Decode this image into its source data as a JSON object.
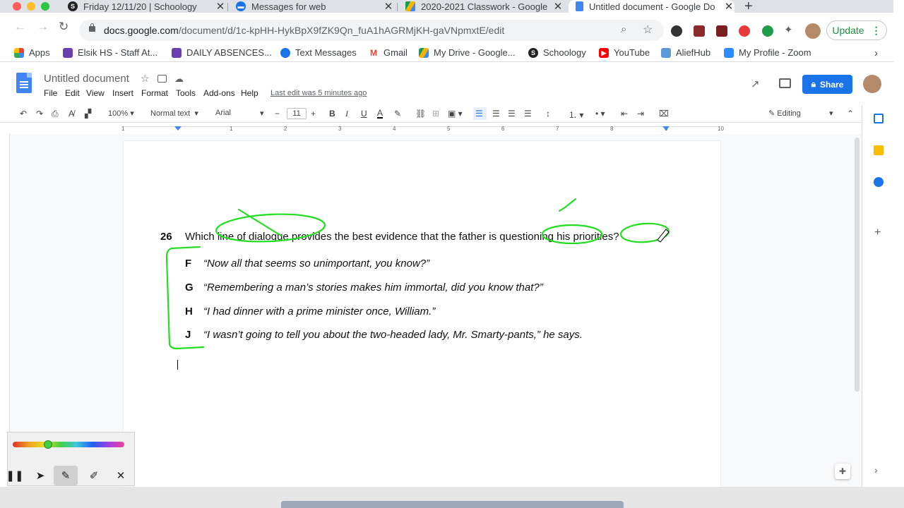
{
  "browser": {
    "tabs": [
      {
        "title": "Friday 12/11/20 | Schoology",
        "icon": "schoology-icon"
      },
      {
        "title": "Messages for web",
        "icon": "messages-icon"
      },
      {
        "title": "2020-2021 Classwork - Google",
        "icon": "google-drive-icon"
      },
      {
        "title": "Untitled document - Google Do",
        "icon": "google-docs-icon"
      }
    ],
    "new_tab": "+",
    "url_host": "docs.google.com",
    "url_path": "/document/d/1c-kpHH-HykBpX9fZK9Qn_fuA1hAGRMjKH-gaVNpmxtE/edit",
    "update_label": "Update",
    "bookmarks": [
      "Apps",
      "Elsik HS - Staff At...",
      "DAILY ABSENCES...",
      "Text Messages",
      "Gmail",
      "My Drive - Google...",
      "Schoology",
      "YouTube",
      "AliefHub",
      "My Profile - Zoom"
    ],
    "bookmarks_more": "›"
  },
  "docs": {
    "title": "Untitled document",
    "menus": [
      "File",
      "Edit",
      "View",
      "Insert",
      "Format",
      "Tools",
      "Add-ons",
      "Help"
    ],
    "last_edit": "Last edit was 5 minutes ago",
    "share_label": "Share",
    "toolbar": {
      "zoom": "100%",
      "style": "Normal text",
      "font": "Arial",
      "font_size": "11",
      "mode": "Editing"
    },
    "ruler_numbers": [
      "1",
      "1",
      "2",
      "3",
      "4",
      "5",
      "6",
      "7",
      "8",
      "9",
      "10"
    ]
  },
  "question": {
    "number": "26",
    "text": "Which line of dialogue provides the best evidence that the father is questioning his priorities?",
    "options": [
      {
        "letter": "F",
        "text": "“Now all that seems so unimportant, you know?”"
      },
      {
        "letter": "G",
        "text": "“Remembering a man’s stories makes him immortal, did you know that?”"
      },
      {
        "letter": "H",
        "text": "“I had dinner with a prime minister once, William.”"
      },
      {
        "letter": "J",
        "text": "“I wasn’t going to tell you about the two-headed lady, Mr. Smarty-pants,” he says."
      }
    ]
  },
  "annotation": {
    "color": "#22dd22"
  },
  "colors": {
    "docs_blue": "#1a73e8",
    "update_green": "#1e8e3e",
    "youtube_red": "#ff0000"
  }
}
